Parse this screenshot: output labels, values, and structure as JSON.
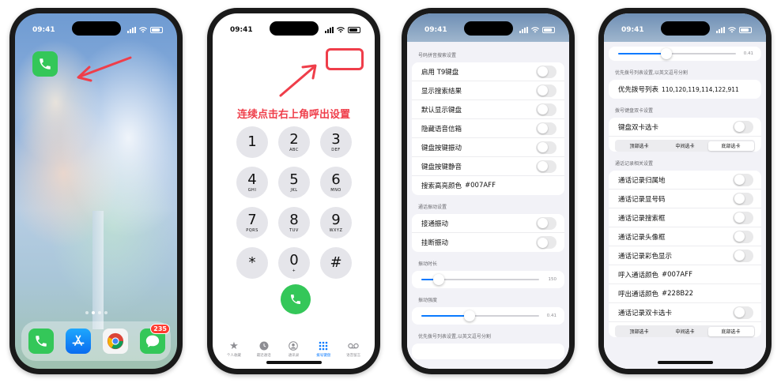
{
  "status": {
    "time": "09:41"
  },
  "phone1": {
    "dock_badge": "235",
    "apps": {
      "phone": "phone-app",
      "appstore": "app-store-app",
      "chrome": "chrome-app",
      "messages": "messages-app"
    },
    "accent_color": "#ef3e4a"
  },
  "phone2": {
    "hint": "连续点击右上角呼出设置",
    "keys": [
      {
        "digit": "1",
        "letters": ""
      },
      {
        "digit": "2",
        "letters": "ABC"
      },
      {
        "digit": "3",
        "letters": "DEF"
      },
      {
        "digit": "4",
        "letters": "GHI"
      },
      {
        "digit": "5",
        "letters": "JKL"
      },
      {
        "digit": "6",
        "letters": "MNO"
      },
      {
        "digit": "7",
        "letters": "PQRS"
      },
      {
        "digit": "8",
        "letters": "TUV"
      },
      {
        "digit": "9",
        "letters": "WXYZ"
      },
      {
        "digit": "*",
        "letters": ""
      },
      {
        "digit": "0",
        "letters": "+"
      },
      {
        "digit": "#",
        "letters": ""
      }
    ],
    "tabs": [
      {
        "label": "个人收藏",
        "icon": "star-icon"
      },
      {
        "label": "最近通话",
        "icon": "clock-icon"
      },
      {
        "label": "通讯录",
        "icon": "person-icon"
      },
      {
        "label": "拨号键盘",
        "icon": "keypad-icon",
        "active": true
      },
      {
        "label": "语音留言",
        "icon": "voicemail-icon"
      }
    ]
  },
  "phone3": {
    "section1_title": "号码拼音搜索设置",
    "section1_rows": [
      {
        "label": "启用 T9键盘",
        "toggle": false
      },
      {
        "label": "显示搜索结果",
        "toggle": false
      },
      {
        "label": "默认显示键盘",
        "toggle": false
      },
      {
        "label": "隐藏语音信箱",
        "toggle": false
      },
      {
        "label": "键盘按键振动",
        "toggle": false
      },
      {
        "label": "键盘按键静音",
        "toggle": false
      }
    ],
    "highlight_label": "搜索高亮颜色",
    "highlight_value": "#007AFF",
    "section2_title": "通话振动设置",
    "section2_rows": [
      {
        "label": "接通振动",
        "toggle": false
      },
      {
        "label": "挂断振动",
        "toggle": false
      }
    ],
    "slider1_title": "振动时长",
    "slider1_value": "150",
    "slider1_fraction": 0.15,
    "slider2_title": "振动强度",
    "slider2_value": "0.41",
    "slider2_fraction": 0.41,
    "section3_title": "优先拨号列表设置,以英文逗号分割"
  },
  "phone4": {
    "top_slider_value": "0.41",
    "top_slider_fraction": 0.41,
    "priority_title": "优先拨号列表设置,以英文逗号分割",
    "priority_label": "优先拨号列表",
    "priority_value": "110,120,119,114,122,911",
    "dual_title": "拨号键盘双卡设置",
    "dual_row": "键盘双卡选卡",
    "segments": [
      "顶部选卡",
      "中间选卡",
      "底部选卡"
    ],
    "segment_selected": 2,
    "calllog_title": "通话记录相关设置",
    "calllog_rows": [
      {
        "label": "通话记录归属地",
        "toggle": false
      },
      {
        "label": "通话记录显号码",
        "toggle": false
      },
      {
        "label": "通话记录搜索框",
        "toggle": false
      },
      {
        "label": "通话记录头像框",
        "toggle": false
      },
      {
        "label": "通话记录彩色显示",
        "toggle": false
      }
    ],
    "incoming_label": "呼入通话颜色",
    "incoming_value": "#007AFF",
    "outgoing_label": "呼出通话颜色",
    "outgoing_value": "#228B22",
    "calllog_dual_row": "通话记录双卡选卡",
    "segments2": [
      "顶部选卡",
      "中间选卡",
      "底部选卡"
    ],
    "segment2_selected": 2
  }
}
